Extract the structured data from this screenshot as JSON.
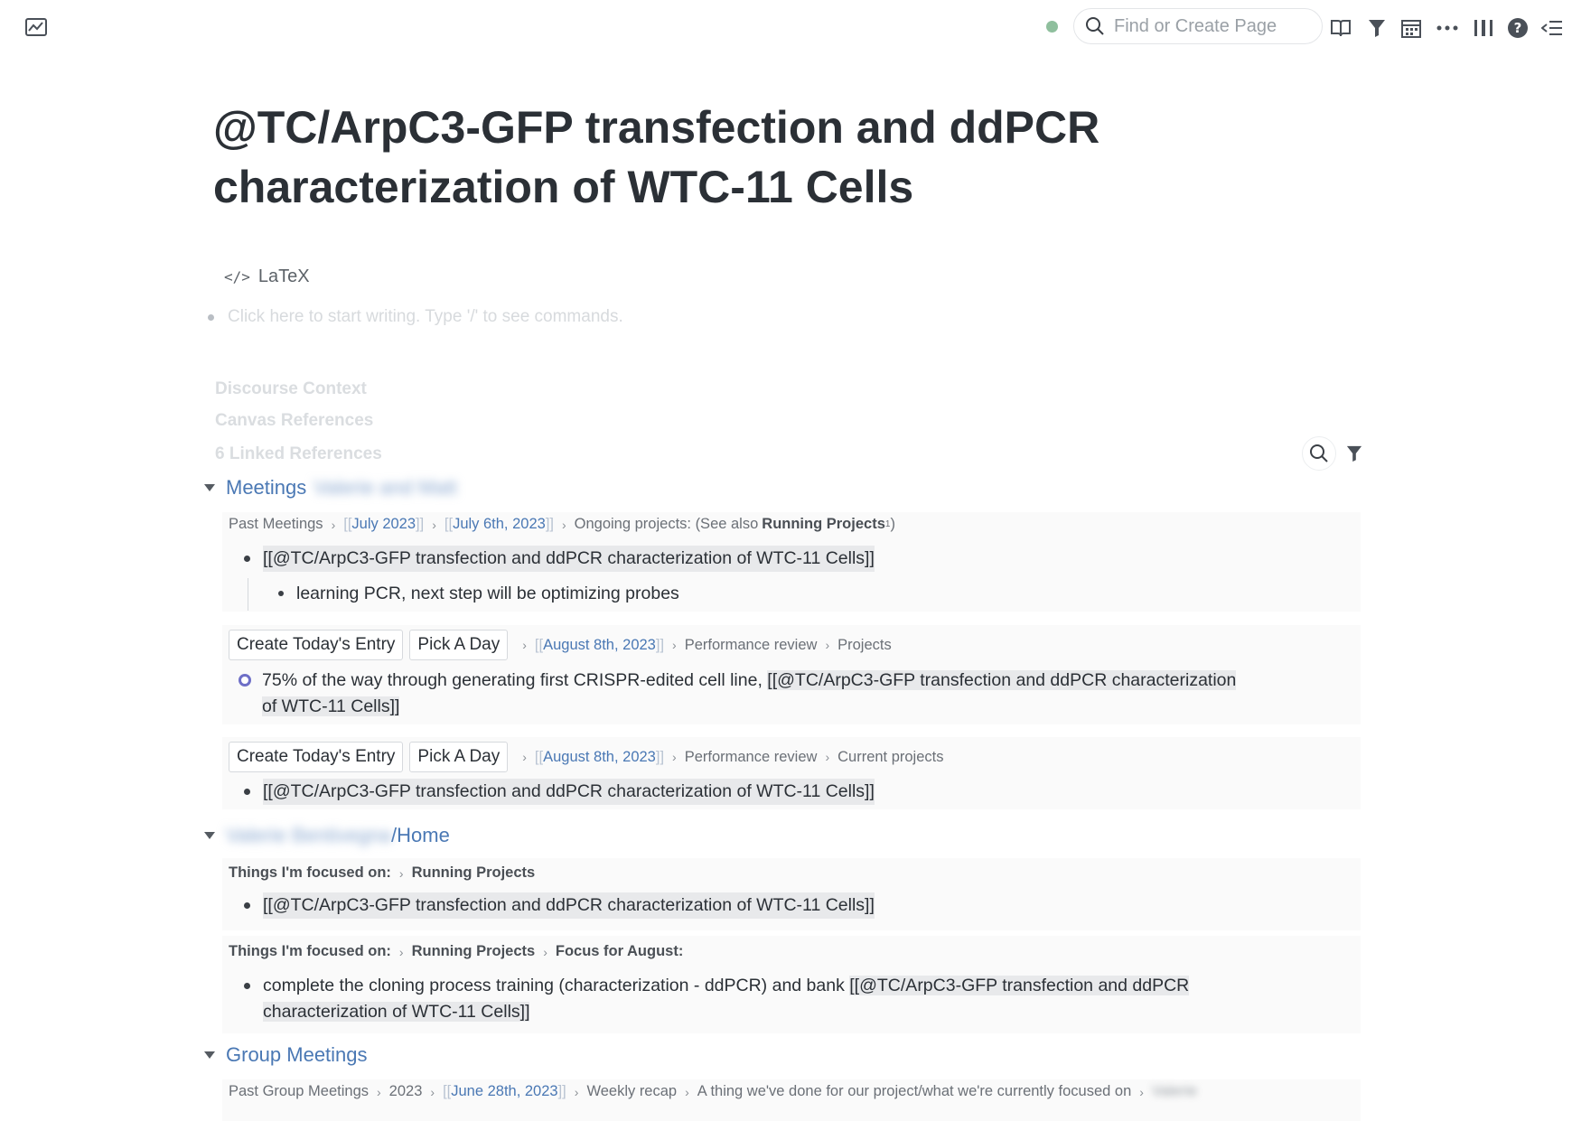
{
  "topbar": {
    "search_placeholder": "Find or Create Page",
    "icons": [
      "graph-icon",
      "book-icon",
      "filter-icon",
      "calendar-icon",
      "more-icon",
      "sidebar-icon",
      "help-icon",
      "right-sidebar-icon"
    ]
  },
  "page": {
    "title": "@TC/ArpC3-GFP transfection and ddPCR characterization of WTC-11 Cells",
    "latex_label": "LaTeX",
    "placeholder": "Click here to start writing. Type '/' to see commands."
  },
  "references": {
    "discourse_context": "Discourse Context",
    "canvas_references": "Canvas References",
    "linked_references": "6 Linked References"
  },
  "groups": [
    {
      "title": "Meetings",
      "title_blurred": "Valerie and Matt",
      "crumbs": {
        "c1": "Past Meetings",
        "c2": "July 2023",
        "c3": "July 6th, 2023",
        "c4": "Ongoing projects: (See also ",
        "c4_bold": "Running Projects",
        "c4_sup": "1",
        "c4_end": ")"
      },
      "block1": "[[@TC/ArpC3-GFP transfection and ddPCR characterization of WTC-11 Cells]]",
      "block1_child": "learning PCR, next step will be optimizing probes",
      "entry_a": {
        "create_label": "Create Today's Entry",
        "pick_label": "Pick A Day",
        "date": "August 8th, 2023",
        "crumb2": "Performance review",
        "crumb3": "Projects",
        "todo_text": "75% of the way through generating first CRISPR-edited cell line, ",
        "todo_ref_1": "[[@TC/ArpC3-GFP transfection and ddPCR characterization",
        "todo_ref_2": "of WTC-11 Cells]]"
      },
      "entry_b": {
        "create_label": "Create Today's Entry",
        "pick_label": "Pick A Day",
        "date": "August 8th, 2023",
        "crumb2": "Performance review",
        "crumb3": "Current projects",
        "block": "[[@TC/ArpC3-GFP transfection and ddPCR characterization of WTC-11 Cells]]"
      }
    },
    {
      "title_blurred": "Valerie Bentivegna",
      "title": "/Home",
      "crumbs_a": {
        "c1": "Things I'm focused on:",
        "c2": "Running Projects"
      },
      "block_a": "[[@TC/ArpC3-GFP transfection and ddPCR characterization of WTC-11 Cells]]",
      "crumbs_b": {
        "c1": "Things I'm focused on:",
        "c2": "Running Projects",
        "c3": "Focus for August:"
      },
      "block_b_text": "complete the cloning process training (characterization - ddPCR) and bank ",
      "block_b_ref_1": "[[@TC/ArpC3-GFP transfection and ddPCR",
      "block_b_ref_2": "characterization of WTC-11 Cells]]"
    },
    {
      "title": "Group Meetings",
      "crumbs": {
        "c1": "Past Group Meetings",
        "c2": "2023",
        "c3": "June 28th, 2023",
        "c4": "Weekly recap",
        "c5": "A thing we've done for our project/what we're currently focused on",
        "c6": "Valerie"
      }
    }
  ],
  "colors": {
    "link": "#4a78b4",
    "todo": "#6e6fc7",
    "status": "#8fbf9d"
  }
}
